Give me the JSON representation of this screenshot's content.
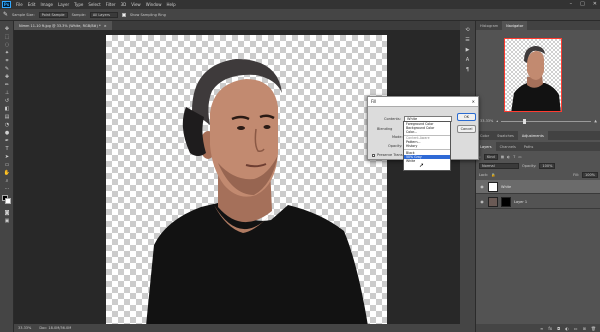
{
  "menubar": {
    "logo": "Ps",
    "items": [
      "File",
      "Edit",
      "Image",
      "Layer",
      "Type",
      "Select",
      "Filter",
      "3D",
      "View",
      "Window",
      "Help"
    ],
    "window_controls": [
      "–",
      "□",
      "✕"
    ]
  },
  "options": {
    "sample_size_label": "Sample Size:",
    "sample_size_value": "Point Sample",
    "sample_label": "Sample:",
    "sample_value": "All Layers",
    "show_ring_label": "Show Sampling Ring"
  },
  "document": {
    "tab_title": "Nimm 11-10 ft.jpg @ 33.3% (White, RGB/8#) *",
    "tab_close": "×"
  },
  "status": {
    "zoom": "33.33%",
    "doc_info": "Doc: 18.0M/36.0M"
  },
  "panels": {
    "top_tabs": [
      "Histogram",
      "Navigator"
    ],
    "zoom_value": "33.33%",
    "mid_tabs": [
      "Color",
      "Swatches",
      "Adjustments"
    ],
    "layer_tabs": [
      "Layers",
      "Channels",
      "Paths"
    ],
    "kind_label": "Kind",
    "blend_mode": "Normal",
    "opacity_label": "Opacity:",
    "opacity_value": "100%",
    "lock_label": "Lock:",
    "fill_label": "Fill:",
    "fill_value": "100%",
    "layers": [
      {
        "name": "White",
        "selected": true
      },
      {
        "name": "Layer 1",
        "selected": false
      }
    ]
  },
  "dialog": {
    "title": "Fill",
    "close": "✕",
    "contents_label": "Contents:",
    "contents_value": "White",
    "blending_label": "Blending",
    "mode_label": "Mode:",
    "opacity_label": "Opacity:",
    "preserve_label": "Preserve Transparency",
    "ok_label": "OK",
    "cancel_label": "Cancel",
    "options": [
      "Foreground Color",
      "Background Color",
      "Color...",
      "Content-Aware",
      "Pattern...",
      "History",
      "Black",
      "50% Gray",
      "White"
    ]
  },
  "colors": {
    "accent": "#2f6ad6",
    "navigator_border": "#ff3b30",
    "canvas_bg": "#282828"
  }
}
